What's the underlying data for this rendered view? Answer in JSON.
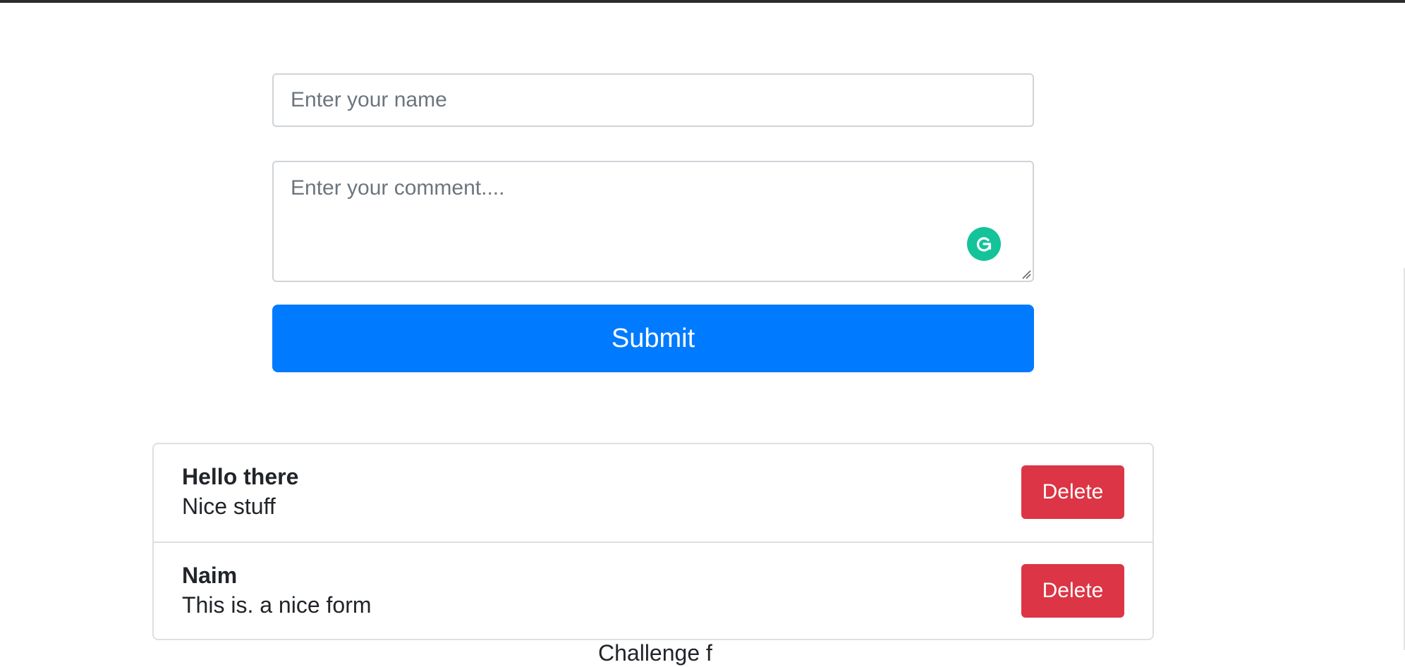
{
  "form": {
    "name_placeholder": "Enter your name",
    "comment_placeholder": "Enter your comment....",
    "submit_label": "Submit"
  },
  "comments": [
    {
      "author": "Hello there",
      "text": "Nice stuff",
      "delete_label": "Delete"
    },
    {
      "author": "Naim",
      "text": "This is. a nice form",
      "delete_label": "Delete"
    }
  ],
  "footer_partial_text": "Challenge f",
  "colors": {
    "primary": "#007bff",
    "danger": "#dc3545",
    "grammarly": "#15c39a"
  },
  "icons": {
    "grammarly": "grammarly-icon",
    "resize": "resize-grip-icon"
  }
}
